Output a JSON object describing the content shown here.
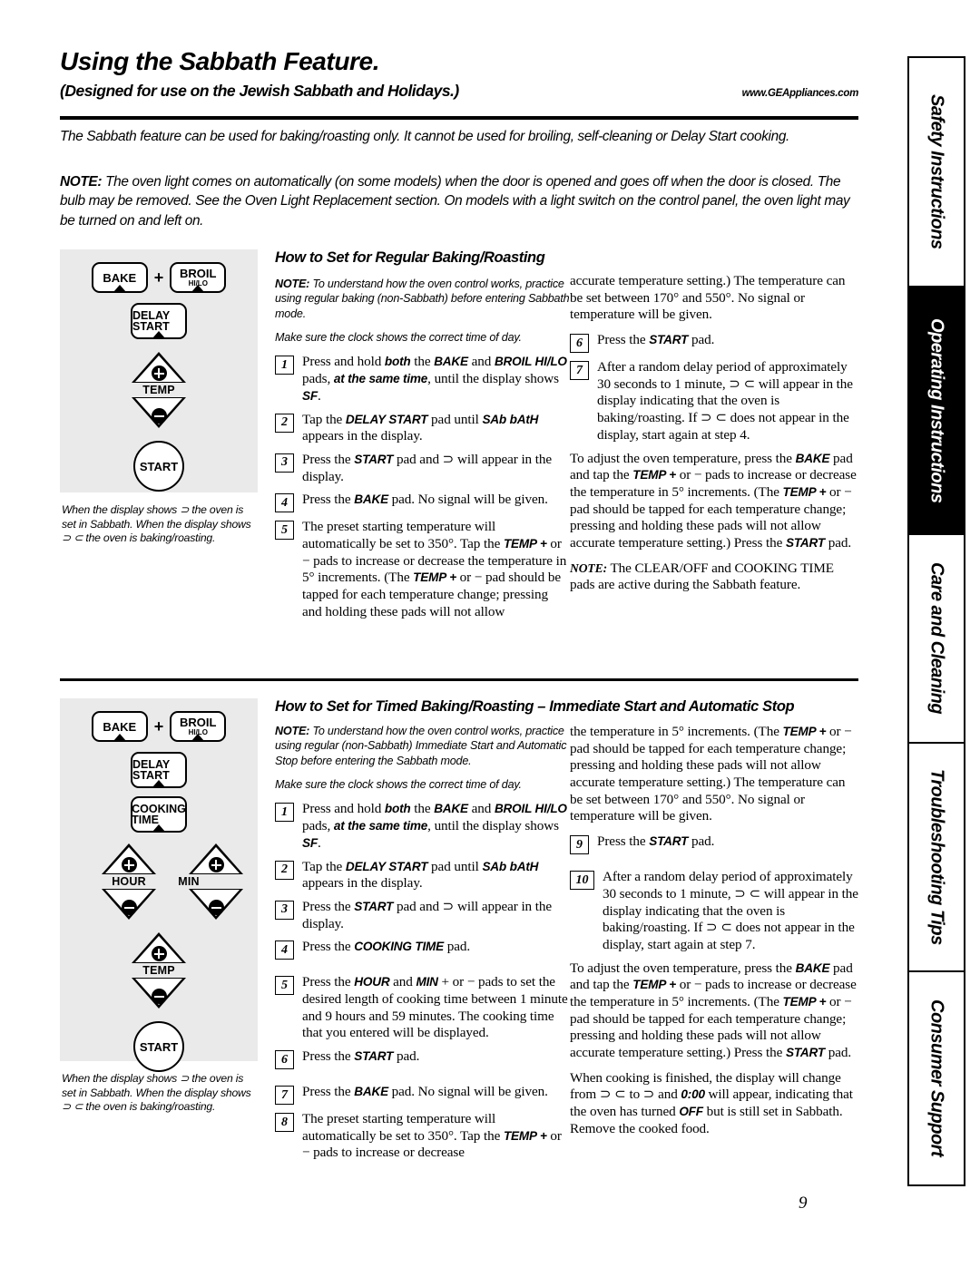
{
  "header": {
    "title": "Using the Sabbath Feature.",
    "subtitle": "(Designed for use on the Jewish Sabbath and Holidays.)",
    "url": "www.GEAppliances.com"
  },
  "intro": "The Sabbath feature can be used for baking/roasting only. It cannot be used for broiling, self-cleaning or Delay Start cooking.",
  "top_note": {
    "label": "NOTE:",
    "text": " The oven light comes on automatically (on some models) when the door is opened and goes off when the door is closed. The bulb may be removed. See the Oven Light Replacement section. On models with a light switch on the control panel, the oven light may be turned on and left on."
  },
  "section1": {
    "heading": "How to Set for Regular Baking/Roasting",
    "note_label": "NOTE:",
    "note_text": " To understand how the oven control works, practice using regular baking (non-Sabbath) before entering Sabbath mode.",
    "clock_note": "Make sure the clock shows the correct time of day.",
    "panel": {
      "bake": "BAKE",
      "plus": "+",
      "broil": "BROIL",
      "broil_sub": "HI/LO",
      "delay_start": "DELAY START",
      "temp": "TEMP",
      "start": "START"
    },
    "panel_caption": "When the display shows ⊃ the oven is set in Sabbath. When the display shows ⊃ ⊂ the oven is baking/roasting.",
    "steps": [
      {
        "num": "1",
        "text": "Press and hold both the BAKE and BROIL HI/LO pads, at the same time, until the display shows SF."
      },
      {
        "num": "2",
        "text": "Tap the DELAY START pad until SAb bAtH appears in the display."
      },
      {
        "num": "3",
        "text": "Press the START pad and ⊃ will appear in the display."
      },
      {
        "num": "4",
        "text": "Press the BAKE pad. No signal will be given."
      },
      {
        "num": "5",
        "text": "The preset starting temperature will automatically be set to 350°. Tap the TEMP + or − pads to increase or decrease the temperature in 5° increments. (The TEMP + or − pad should be tapped for each temperature change; pressing and holding these pads will not allow"
      },
      {
        "num": "6",
        "text": "Press the START pad."
      },
      {
        "num": "7",
        "text": "After a random delay period of approximately 30 seconds to 1 minute, ⊃ ⊂ will appear in the display indicating that the oven is baking/roasting. If ⊃ ⊂ does not appear in the display, start again at step 4."
      }
    ],
    "continuation": "accurate temperature setting.) The temperature can be set between 170° and 550°. No signal or temperature will be given.",
    "adjust_para": "To adjust the oven temperature, press the BAKE pad and tap the TEMP + or − pads to increase or decrease the temperature in 5° increments. (The TEMP + or − pad should be tapped for each temperature change; pressing and holding these pads will not allow accurate temperature setting.) Press the START pad.",
    "bottom_note_label": "NOTE:",
    "bottom_note_text": " The CLEAR/OFF and COOKING TIME pads are active during the Sabbath feature."
  },
  "section2": {
    "heading": "How to Set for Timed Baking/Roasting – Immediate Start and Automatic Stop",
    "note_label": "NOTE:",
    "note_text": " To understand how the oven control works, practice using regular (non-Sabbath) Immediate Start and Automatic Stop before entering the Sabbath mode.",
    "clock_note": "Make sure the clock shows the correct time of day.",
    "panel": {
      "bake": "BAKE",
      "plus": "+",
      "broil": "BROIL",
      "broil_sub": "HI/LO",
      "delay_start": "DELAY START",
      "cooking_time": "COOKING TIME",
      "hour": "HOUR",
      "min": "MIN",
      "temp": "TEMP",
      "start": "START"
    },
    "panel_caption": "When the display shows ⊃ the oven is set in Sabbath. When the display shows ⊃ ⊂ the oven is baking/roasting.",
    "steps": [
      {
        "num": "1",
        "text": "Press and hold both the BAKE and BROIL HI/LO pads, at the same time, until the display shows SF."
      },
      {
        "num": "2",
        "text": "Tap the DELAY START pad until SAb bAtH appears in the display."
      },
      {
        "num": "3",
        "text": "Press the START pad and ⊃ will appear in the display."
      },
      {
        "num": "4",
        "text": "Press the COOKING TIME pad."
      },
      {
        "num": "5",
        "text": "Press the HOUR and MIN + or − pads to set the desired length of cooking time between 1 minute and 9 hours and 59 minutes. The cooking time that you entered will be displayed."
      },
      {
        "num": "6",
        "text": "Press the START pad."
      },
      {
        "num": "7",
        "text": "Press the BAKE pad. No signal will be given."
      },
      {
        "num": "8",
        "text": "The preset starting temperature will automatically be set to 350°. Tap the TEMP + or − pads to increase or decrease"
      },
      {
        "num": "9",
        "text": "Press the START pad."
      },
      {
        "num": "10",
        "text": "After a random delay period of approximately 30 seconds to 1 minute, ⊃ ⊂ will appear in the display indicating that the oven is baking/roasting. If ⊃ ⊂ does not appear in the display, start again at step 7."
      }
    ],
    "continuation": "the temperature in 5° increments. (The TEMP + or − pad should be tapped for each temperature change; pressing and holding these pads will not allow accurate temperature setting.) The temperature can be set between 170° and 550°. No signal or temperature will be given.",
    "adjust_para": "To adjust the oven temperature, press the BAKE pad and tap the TEMP + or − pads to increase or decrease the temperature in 5° increments. (The TEMP + or − pad should be tapped for each temperature change; pressing and holding these pads will not allow accurate temperature setting.) Press the START pad.",
    "finish_para": "When cooking is finished, the display will change from ⊃ ⊂ to ⊃ and 0:00 will appear, indicating that the oven has turned OFF but is still set in Sabbath. Remove the cooked food."
  },
  "sidebar": {
    "tabs": [
      {
        "label": "Safety Instructions",
        "active": false
      },
      {
        "label": "Operating Instructions",
        "active": true
      },
      {
        "label": "Care and Cleaning",
        "active": false
      },
      {
        "label": "Troubleshooting Tips",
        "active": false
      },
      {
        "label": "Consumer Support",
        "active": false
      }
    ]
  },
  "page_number": "9"
}
